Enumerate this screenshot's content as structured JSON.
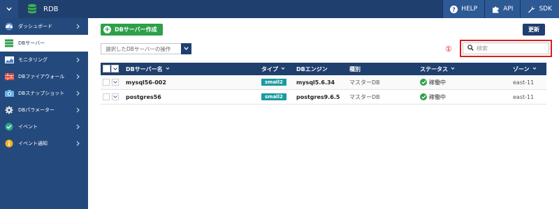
{
  "topbar": {
    "title": "RDB",
    "buttons": [
      {
        "label": "HELP",
        "icon": "help-icon"
      },
      {
        "label": "API",
        "icon": "puzzle-icon"
      },
      {
        "label": "SDK",
        "icon": "wrench-icon"
      }
    ]
  },
  "sidebar": {
    "items": [
      {
        "label": "ダッシュボード",
        "icon": "dashboard-icon",
        "active": false
      },
      {
        "label": "DBサーバー",
        "icon": "db-server-icon",
        "active": true
      },
      {
        "label": "モニタリング",
        "icon": "monitoring-icon",
        "active": false
      },
      {
        "label": "DBファイアウォール",
        "icon": "firewall-icon",
        "active": false
      },
      {
        "label": "DBスナップショット",
        "icon": "camera-icon",
        "active": false
      },
      {
        "label": "DBパラメーター",
        "icon": "gear-icon",
        "active": false
      },
      {
        "label": "イベント",
        "icon": "event-icon",
        "active": false
      },
      {
        "label": "イベント通知",
        "icon": "info-icon",
        "active": false
      }
    ]
  },
  "toolbar": {
    "create_label": "DBサーバー作成",
    "refresh_label": "更新",
    "ops_select_label": "選択したDBサーバーの操作",
    "callout": "①",
    "search_placeholder": "検索"
  },
  "table": {
    "headers": {
      "name": "DBサーバー名",
      "type": "タイプ",
      "engine": "DBエンジン",
      "kind": "種別",
      "status": "ステータス",
      "zone": "ゾーン"
    },
    "rows": [
      {
        "name": "mysql56-002",
        "type": "small2",
        "engine": "mysql5.6.34",
        "kind": "マスターDB",
        "status": "稼働中",
        "zone": "east-11"
      },
      {
        "name": "postgres56",
        "type": "small2",
        "engine": "postgres9.6.5",
        "kind": "マスターDB",
        "status": "稼働中",
        "zone": "east-11"
      }
    ]
  },
  "colors": {
    "header": "#1f3f6e",
    "sidebar": "#24497c",
    "create_button": "#2e9f4a",
    "badge": "#1a9aa0",
    "callout": "#d61e1e"
  }
}
